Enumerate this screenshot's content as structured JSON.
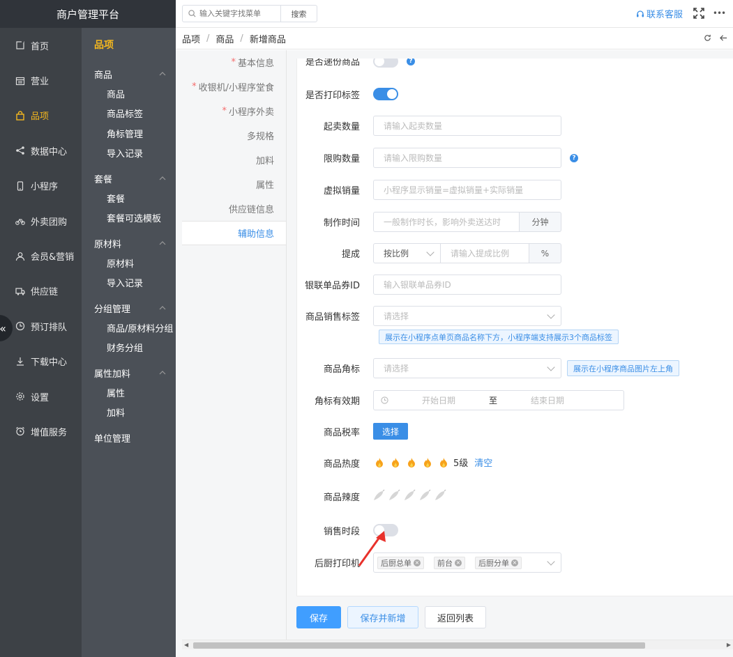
{
  "app": {
    "title": "商户管理平台"
  },
  "nav": {
    "items": [
      {
        "label": "首页",
        "icon": "home-icon"
      },
      {
        "label": "营业",
        "icon": "calendar-icon"
      },
      {
        "label": "品项",
        "icon": "bag-icon",
        "active": true
      },
      {
        "label": "数据中心",
        "icon": "share-icon"
      },
      {
        "label": "小程序",
        "icon": "phone-icon"
      },
      {
        "label": "外卖团购",
        "icon": "bike-icon"
      },
      {
        "label": "会员&营销",
        "icon": "user-icon"
      },
      {
        "label": "供应链",
        "icon": "truck-icon"
      },
      {
        "label": "预订排队",
        "icon": "clock-icon"
      },
      {
        "label": "下载中心",
        "icon": "download-icon"
      },
      {
        "label": "设置",
        "icon": "gear-icon"
      },
      {
        "label": "增值服务",
        "icon": "alarm-icon"
      }
    ],
    "collapse_glyph": "«"
  },
  "subnav": {
    "header": "品项",
    "groups": [
      {
        "label": "商品",
        "items": [
          "商品",
          "商品标签",
          "角标管理",
          "导入记录"
        ]
      },
      {
        "label": "套餐",
        "items": [
          "套餐",
          "套餐可选模板"
        ]
      },
      {
        "label": "原材料",
        "items": [
          "原材料",
          "导入记录"
        ]
      },
      {
        "label": "分组管理",
        "items": [
          "商品/原材料分组",
          "财务分组"
        ]
      },
      {
        "label": "属性加料",
        "items": [
          "属性",
          "加料"
        ]
      }
    ],
    "last": "单位管理"
  },
  "topbar": {
    "search_placeholder": "输入关键字找菜单",
    "search_button": "搜索",
    "support": "联系客服",
    "more": "•••"
  },
  "breadcrumb": [
    "品项",
    "商品",
    "新增商品"
  ],
  "tabs": [
    {
      "label": "基本信息",
      "required": true
    },
    {
      "label": "收银机/小程序堂食",
      "required": true
    },
    {
      "label": "小程序外卖",
      "required": true
    },
    {
      "label": "多规格",
      "required": false
    },
    {
      "label": "加料",
      "required": false
    },
    {
      "label": "属性",
      "required": false
    },
    {
      "label": "供应链信息",
      "required": false
    },
    {
      "label": "辅助信息",
      "required": false,
      "active": true
    }
  ],
  "form": {
    "top_cut_label": "是否递份商品",
    "print_label": {
      "label": "是否打印标签",
      "on": true
    },
    "min_qty": {
      "label": "起卖数量",
      "placeholder": "请输入起卖数量"
    },
    "limit_qty": {
      "label": "限购数量",
      "placeholder": "请输入限购数量"
    },
    "virtual_sales": {
      "label": "虚拟销量",
      "placeholder": "小程序显示销量=虚拟销量+实际销量"
    },
    "make_time": {
      "label": "制作时间",
      "placeholder": "一般制作时长，影响外卖送达时",
      "unit": "分钟"
    },
    "commission": {
      "label": "提成",
      "mode": "按比例",
      "placeholder": "请输入提成比例",
      "unit": "%"
    },
    "unionpay": {
      "label": "银联单品券ID",
      "placeholder": "输入银联单品券ID"
    },
    "sales_tag": {
      "label": "商品销售标签",
      "placeholder": "请选择",
      "tip": "展示在小程序点单页商品名称下方，小程序端支持展示3个商品标签"
    },
    "corner": {
      "label": "商品角标",
      "placeholder": "请选择",
      "tip": "展示在小程序商品图片左上角"
    },
    "corner_valid": {
      "label": "角标有效期",
      "start": "开始日期",
      "to": "至",
      "end": "结束日期"
    },
    "tax": {
      "label": "商品税率",
      "button": "选择"
    },
    "heat": {
      "label": "商品热度",
      "level": 5,
      "max": 5,
      "level_text": "5级",
      "clear": "清空"
    },
    "spicy": {
      "label": "商品辣度",
      "level": 0,
      "max": 5
    },
    "sale_period": {
      "label": "销售时段",
      "on": false
    },
    "printer": {
      "label": "后厨打印机",
      "tags": [
        "后厨总单",
        "前台",
        "后厨分单"
      ]
    }
  },
  "buttons": {
    "save": "保存",
    "save_new": "保存并新增",
    "back": "返回列表"
  },
  "colors": {
    "accent": "#3a8ee6",
    "nav_active": "#f5b81e",
    "arrow": "#e8312b"
  }
}
